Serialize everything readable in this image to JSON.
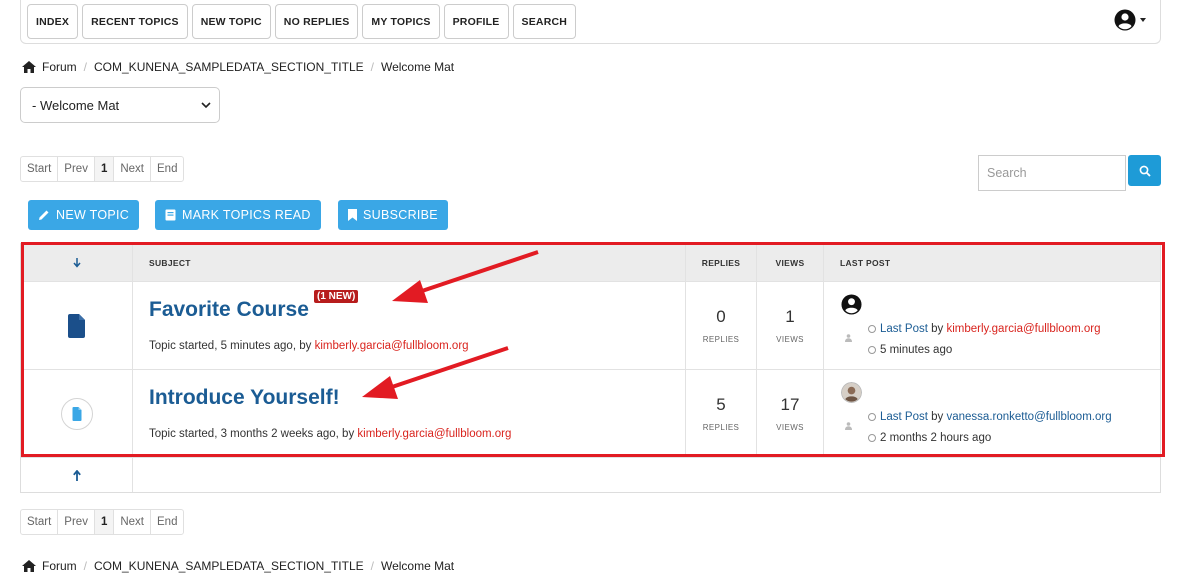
{
  "nav": {
    "items": [
      "INDEX",
      "RECENT TOPICS",
      "NEW TOPIC",
      "NO REPLIES",
      "MY TOPICS",
      "PROFILE",
      "SEARCH"
    ]
  },
  "breadcrumb": {
    "items": [
      "Forum",
      "COM_KUNENA_SAMPLEDATA_SECTION_TITLE",
      "Welcome Mat"
    ]
  },
  "category_select": {
    "value": "- Welcome Mat"
  },
  "pagination": {
    "items": [
      "Start",
      "Prev",
      "1",
      "Next",
      "End"
    ],
    "active": "1"
  },
  "search": {
    "placeholder": "Search"
  },
  "actions": {
    "new_topic": "NEW TOPIC",
    "mark_read": "MARK TOPICS READ",
    "subscribe": "SUBSCRIBE"
  },
  "table": {
    "headers": {
      "subject": "SUBJECT",
      "replies": "REPLIES",
      "views": "VIEWS",
      "last_post": "LAST POST"
    },
    "topics": [
      {
        "title": "Favorite Course",
        "badge": "(1 NEW)",
        "meta_prefix": "Topic started, 5 minutes ago, by ",
        "author": "kimberly.garcia@fullbloom.org",
        "replies": "0",
        "replies_label": "REPLIES",
        "views": "1",
        "views_label": "VIEWS",
        "last_post_link": "Last Post",
        "last_post_by": " by ",
        "last_post_user": "kimberly.garcia@fullbloom.org",
        "last_post_time": "5 minutes ago"
      },
      {
        "title": "Introduce Yourself!",
        "meta_prefix": "Topic started, 3 months 2 weeks ago, by ",
        "author": "kimberly.garcia@fullbloom.org",
        "replies": "5",
        "replies_label": "REPLIES",
        "views": "17",
        "views_label": "VIEWS",
        "last_post_link": "Last Post",
        "last_post_by": " by ",
        "last_post_user": "vanessa.ronketto@fullbloom.org",
        "last_post_time": "2 months 2 hours ago"
      }
    ]
  },
  "colors": {
    "accent": "#3aa7e6",
    "link": "#1b5c94",
    "user_red": "#d9241e",
    "highlight": "#e21b23"
  }
}
